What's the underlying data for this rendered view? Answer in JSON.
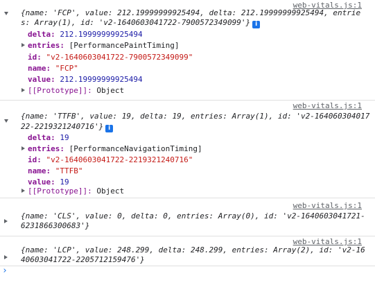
{
  "source_link": "web-vitals.js:1",
  "logs": [
    {
      "summary_1": "{name: 'FCP', value: 212.19999999925494, delta: 212.19999999925494, entrie",
      "summary_2": "s: Array(1), id: 'v2-1640603041722-7900572349099'}",
      "props": [
        {
          "key": "delta",
          "value": "212.19999999925494",
          "kind": "num"
        },
        {
          "key": "entries",
          "value": "[PerformancePaintTiming]",
          "kind": "plain"
        },
        {
          "key": "id",
          "value": "\"v2-1640603041722-7900572349099\"",
          "kind": "str"
        },
        {
          "key": "name",
          "value": "\"FCP\"",
          "kind": "str"
        },
        {
          "key": "value",
          "value": "212.19999999925494",
          "kind": "num"
        }
      ],
      "prototype_key": "[[Prototype]]",
      "prototype_value": "Object"
    },
    {
      "summary_1": "{name: 'TTFB', value: 19, delta: 19, entries: Array(1), id: 'v2-164060304017",
      "summary_2": "22-2219321240716'}",
      "props": [
        {
          "key": "delta",
          "value": "19",
          "kind": "num"
        },
        {
          "key": "entries",
          "value": "[PerformanceNavigationTiming]",
          "kind": "plain"
        },
        {
          "key": "id",
          "value": "\"v2-1640603041722-2219321240716\"",
          "kind": "str"
        },
        {
          "key": "name",
          "value": "\"TTFB\"",
          "kind": "str"
        },
        {
          "key": "value",
          "value": "19",
          "kind": "num"
        }
      ],
      "prototype_key": "[[Prototype]]",
      "prototype_value": "Object"
    },
    {
      "summary_1": "{name: 'CLS', value: 0, delta: 0, entries: Array(0), id: 'v2-1640603041721-",
      "summary_2": "6231866300683'}"
    },
    {
      "summary_1": "{name: 'LCP', value: 248.299, delta: 248.299, entries: Array(2), id: 'v2-16",
      "summary_2": "40603041722-2205712159476'}"
    }
  ],
  "info_badge": "i",
  "prompt_symbol": "›"
}
